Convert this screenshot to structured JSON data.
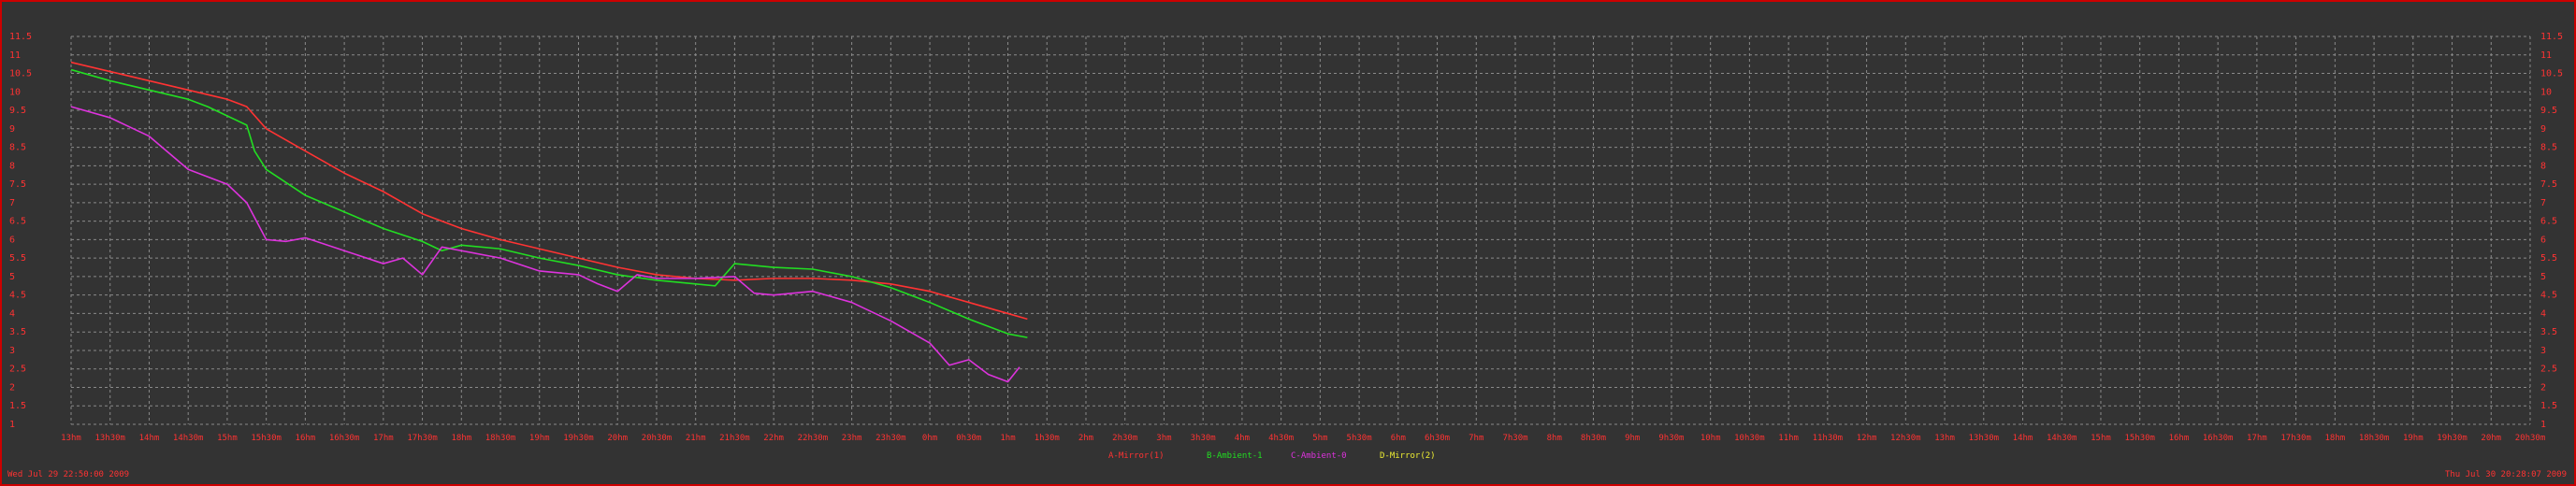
{
  "colors": {
    "background": "#333333",
    "grid": "#8a8a8a",
    "axis_text": "#ff3333",
    "border": "#cc0000"
  },
  "timestamps": {
    "left": "Wed Jul 29 22:50:00 2009",
    "right": "Thu Jul 30 20:28:07 2009"
  },
  "chart_data": {
    "type": "line",
    "title": "",
    "xlabel": "",
    "ylabel": "",
    "ylim": [
      1,
      11.5
    ],
    "y_ticks": [
      "1",
      "1.5",
      "2",
      "2.5",
      "3",
      "3.5",
      "4",
      "4.5",
      "5",
      "5.5",
      "6",
      "6.5",
      "7",
      "7.5",
      "8",
      "8.5",
      "9",
      "9.5",
      "10",
      "10.5",
      "11",
      "11.5"
    ],
    "x_ticks": [
      "13hm",
      "13h30m",
      "14hm",
      "14h30m",
      "15hm",
      "15h30m",
      "16hm",
      "16h30m",
      "17hm",
      "17h30m",
      "18hm",
      "18h30m",
      "19hm",
      "19h30m",
      "20hm",
      "20h30m",
      "21hm",
      "21h30m",
      "22hm",
      "22h30m",
      "23hm",
      "23h30m",
      "0hm",
      "0h30m",
      "1hm",
      "1h30m",
      "2hm",
      "2h30m",
      "3hm",
      "3h30m",
      "4hm",
      "4h30m",
      "5hm",
      "5h30m",
      "6hm",
      "6h30m",
      "7hm",
      "7h30m",
      "8hm",
      "8h30m",
      "9hm",
      "9h30m",
      "10hm",
      "10h30m",
      "11hm",
      "11h30m",
      "12hm",
      "12h30m",
      "13hm",
      "13h30m",
      "14hm",
      "14h30m",
      "15hm",
      "15h30m",
      "16hm",
      "16h30m",
      "17hm",
      "17h30m",
      "18hm",
      "18h30m",
      "19hm",
      "19h30m",
      "20hm",
      "20h30m"
    ],
    "grid": true,
    "legend_position": "bottom-center",
    "series": [
      {
        "name": "A-Mirror(1)",
        "color": "#ff3333",
        "points": [
          [
            0,
            10.8
          ],
          [
            1,
            10.55
          ],
          [
            2,
            10.3
          ],
          [
            3,
            10.05
          ],
          [
            4,
            9.8
          ],
          [
            4.5,
            9.6
          ],
          [
            5,
            9.0
          ],
          [
            6,
            8.4
          ],
          [
            7,
            7.8
          ],
          [
            8,
            7.3
          ],
          [
            9,
            6.7
          ],
          [
            10,
            6.3
          ],
          [
            11,
            6.0
          ],
          [
            12,
            5.75
          ],
          [
            13,
            5.5
          ],
          [
            14,
            5.25
          ],
          [
            15,
            5.05
          ],
          [
            16,
            4.95
          ],
          [
            17,
            4.9
          ],
          [
            18,
            4.95
          ],
          [
            19,
            4.95
          ],
          [
            20,
            4.9
          ],
          [
            21,
            4.8
          ],
          [
            22,
            4.6
          ],
          [
            23,
            4.3
          ],
          [
            24,
            4.0
          ],
          [
            24.5,
            3.85
          ]
        ]
      },
      {
        "name": "B-Ambient-1",
        "color": "#22dd22",
        "points": [
          [
            0,
            10.6
          ],
          [
            1,
            10.3
          ],
          [
            2,
            10.05
          ],
          [
            3,
            9.8
          ],
          [
            3.5,
            9.6
          ],
          [
            4,
            9.35
          ],
          [
            4.5,
            9.1
          ],
          [
            4.7,
            8.4
          ],
          [
            5,
            7.9
          ],
          [
            6,
            7.2
          ],
          [
            7,
            6.75
          ],
          [
            8,
            6.3
          ],
          [
            9,
            5.95
          ],
          [
            9.5,
            5.7
          ],
          [
            10,
            5.85
          ],
          [
            11,
            5.75
          ],
          [
            12,
            5.5
          ],
          [
            13,
            5.3
          ],
          [
            14,
            5.05
          ],
          [
            15,
            4.9
          ],
          [
            16,
            4.8
          ],
          [
            16.5,
            4.75
          ],
          [
            17,
            5.35
          ],
          [
            18,
            5.25
          ],
          [
            19,
            5.2
          ],
          [
            20,
            5.0
          ],
          [
            21,
            4.7
          ],
          [
            22,
            4.3
          ],
          [
            23,
            3.85
          ],
          [
            24,
            3.45
          ],
          [
            24.5,
            3.35
          ]
        ]
      },
      {
        "name": "C-Ambient-0",
        "color": "#dd33dd",
        "points": [
          [
            0,
            9.6
          ],
          [
            1,
            9.3
          ],
          [
            2,
            8.8
          ],
          [
            3,
            7.9
          ],
          [
            4,
            7.5
          ],
          [
            4.5,
            7.0
          ],
          [
            5,
            6.0
          ],
          [
            5.5,
            5.95
          ],
          [
            6,
            6.05
          ],
          [
            7,
            5.7
          ],
          [
            8,
            5.35
          ],
          [
            8.5,
            5.5
          ],
          [
            9,
            5.05
          ],
          [
            9.5,
            5.8
          ],
          [
            10,
            5.7
          ],
          [
            11,
            5.5
          ],
          [
            12,
            5.15
          ],
          [
            13,
            5.05
          ],
          [
            13.5,
            4.8
          ],
          [
            14,
            4.6
          ],
          [
            14.5,
            5.05
          ],
          [
            15,
            4.95
          ],
          [
            16,
            4.95
          ],
          [
            17,
            5.0
          ],
          [
            17.5,
            4.55
          ],
          [
            18,
            4.5
          ],
          [
            19,
            4.6
          ],
          [
            20,
            4.3
          ],
          [
            21,
            3.8
          ],
          [
            22,
            3.2
          ],
          [
            22.5,
            2.6
          ],
          [
            23,
            2.75
          ],
          [
            23.5,
            2.35
          ],
          [
            24,
            2.15
          ],
          [
            24.3,
            2.55
          ]
        ]
      },
      {
        "name": "D-Mirror(2)",
        "color": "#eeee33",
        "points": []
      }
    ]
  }
}
